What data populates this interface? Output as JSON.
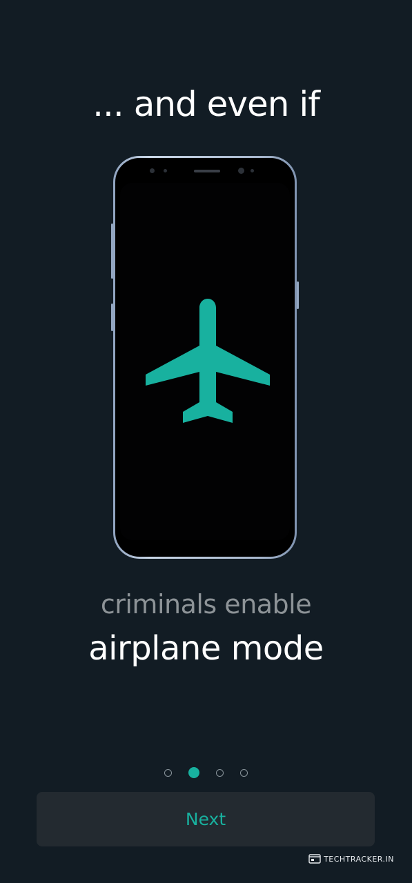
{
  "onboarding": {
    "heading": "... and even if",
    "caption_line1": "criminals enable",
    "caption_line2": "airplane mode",
    "illustration_icon": "airplane-icon",
    "page_indicator": {
      "total": 4,
      "current": 2
    },
    "next_label": "Next"
  },
  "watermark": {
    "text": "TECHTRACKER.IN"
  },
  "colors": {
    "background": "#121c24",
    "accent": "#18b19f",
    "button_bg": "#232a30",
    "muted_text": "#8d9397"
  }
}
